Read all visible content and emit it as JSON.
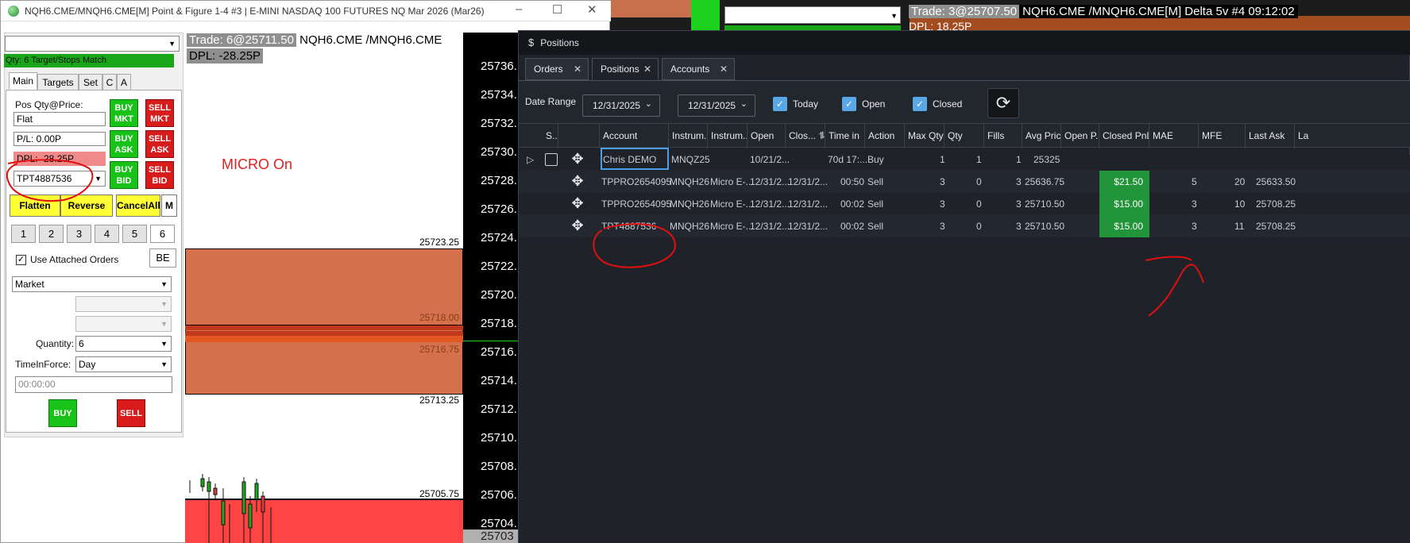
{
  "left_window": {
    "title": "NQH6.CME/MNQH6.CME[M]  Point & Figure 1-4 #3 | E-MINI NASDAQ 100 FUTURES NQ Mar 2026 (Mar26)",
    "minimize": "–",
    "maximize": "☐",
    "close": "✕"
  },
  "order_panel": {
    "top_combo_value": "",
    "qty_match": "Qty: 6 Target/Stops Match",
    "tabs": [
      "Main",
      "Targets",
      "Set",
      "C",
      "A"
    ],
    "pos_qty_label": "Pos Qty@Price:",
    "pos_qty_value": "Flat",
    "pnl_value": "P/L: 0.00P",
    "dpl_value": "DPL: -28.25P",
    "account_value": "TPT4887536",
    "buy_mkt": "BUY MKT",
    "sell_mkt": "SELL MKT",
    "buy_ask": "BUY ASK",
    "sell_ask": "SELL ASK",
    "buy_bid": "BUY BID",
    "sell_bid": "SELL BID",
    "flatten": "Flatten",
    "reverse": "Reverse",
    "cancel_all": "CancelAll",
    "m_button": "M",
    "quick_qty": [
      "1",
      "2",
      "3",
      "4",
      "5",
      "6"
    ],
    "use_attached_label": "Use Attached Orders",
    "use_attached_checked": "✓",
    "be_button": "BE",
    "order_type": "Market",
    "quantity_label": "Quantity:",
    "quantity_value": "6",
    "tif_label": "TimeInForce:",
    "tif_value": "Day",
    "time_value": "00:00:00",
    "buy": "BUY",
    "sell": "SELL"
  },
  "chart": {
    "trade_label": "Trade: 6@25711.50",
    "symbol": "NQH6.CME /MNQH6.CME",
    "dpl": "DPL: -28.25P",
    "micro_status": "MICRO On",
    "price_labels": [
      "25723.25",
      "25718.00",
      "25716.75",
      "25713.25",
      "25705.75"
    ],
    "axis_ticks": [
      "25736.",
      "25734.",
      "25732.",
      "25730.",
      "25728.",
      "25726.",
      "25724.",
      "25722.",
      "25720.",
      "25718.",
      "25716.",
      "25714.",
      "25712.",
      "25710.",
      "25708.",
      "25706.",
      "25704.",
      "25703"
    ]
  },
  "right_chart": {
    "trade_label": "Trade: 3@25707.50",
    "symbol": "NQH6.CME /MNQH6.CME[M]  Delta 5v #4 09:12:02",
    "dpl": "DPL: 18.25P"
  },
  "positions_window": {
    "icon": "$",
    "title": "Positions",
    "tabs": [
      {
        "label": "Orders",
        "active": false
      },
      {
        "label": "Positions",
        "active": true
      },
      {
        "label": "Accounts",
        "active": false
      }
    ],
    "date_range_label": "Date Range",
    "date_from": "12/31/2025",
    "date_to": "12/31/2025",
    "filters": [
      {
        "label": "Today",
        "checked": true
      },
      {
        "label": "Open",
        "checked": true
      },
      {
        "label": "Closed",
        "checked": true
      }
    ],
    "columns": [
      "S...",
      "",
      "Account",
      "Instrum...",
      "Instrum...",
      "Open",
      "Clos...",
      "Time in",
      "Action",
      "Max Qty",
      "Qty",
      "Fills",
      "Avg Price",
      "Open P...",
      "Closed PnL",
      "MAE",
      "MFE",
      "Last Ask",
      "La"
    ],
    "rows": [
      {
        "account": "Chris DEMO",
        "instrument": "MNQZ25",
        "instrument2": "",
        "open": "10/21/2...",
        "close": "",
        "time_in": "70d 17:...",
        "action": "Buy",
        "max_qty": "1",
        "qty": "1",
        "fills": "1",
        "avg_price": "25325",
        "open_pnl": "",
        "closed_pnl": "",
        "mae": "",
        "mfe": "",
        "last_ask": ""
      },
      {
        "account": "TPPRO2654095",
        "instrument": "MNQH26",
        "instrument2": "Micro E-...",
        "open": "12/31/2...",
        "close": "12/31/2...",
        "time_in": "00:50",
        "action": "Sell",
        "max_qty": "3",
        "qty": "0",
        "fills": "3",
        "avg_price": "25636.75",
        "open_pnl": "",
        "closed_pnl": "$21.50",
        "mae": "5",
        "mfe": "20",
        "last_ask": "25633.50"
      },
      {
        "account": "TPPRO2654095",
        "instrument": "MNQH26",
        "instrument2": "Micro E-...",
        "open": "12/31/2...",
        "close": "12/31/2...",
        "time_in": "00:02",
        "action": "Sell",
        "max_qty": "3",
        "qty": "0",
        "fills": "3",
        "avg_price": "25710.50",
        "open_pnl": "",
        "closed_pnl": "$15.00",
        "mae": "3",
        "mfe": "10",
        "last_ask": "25708.25"
      },
      {
        "account": "TPT4887536",
        "instrument": "MNQH26",
        "instrument2": "Micro E-...",
        "open": "12/31/2...",
        "close": "12/31/2...",
        "time_in": "00:02",
        "action": "Sell",
        "max_qty": "3",
        "qty": "0",
        "fills": "3",
        "avg_price": "25710.50",
        "open_pnl": "",
        "closed_pnl": "$15.00",
        "mae": "3",
        "mfe": "11",
        "last_ask": "25708.25"
      }
    ]
  },
  "colors": {
    "buy_green": "#19c219",
    "sell_red": "#d81c1c",
    "pnl_green": "#22943a",
    "panel_dark": "#1f2329",
    "annotation_red": "#e01010"
  }
}
